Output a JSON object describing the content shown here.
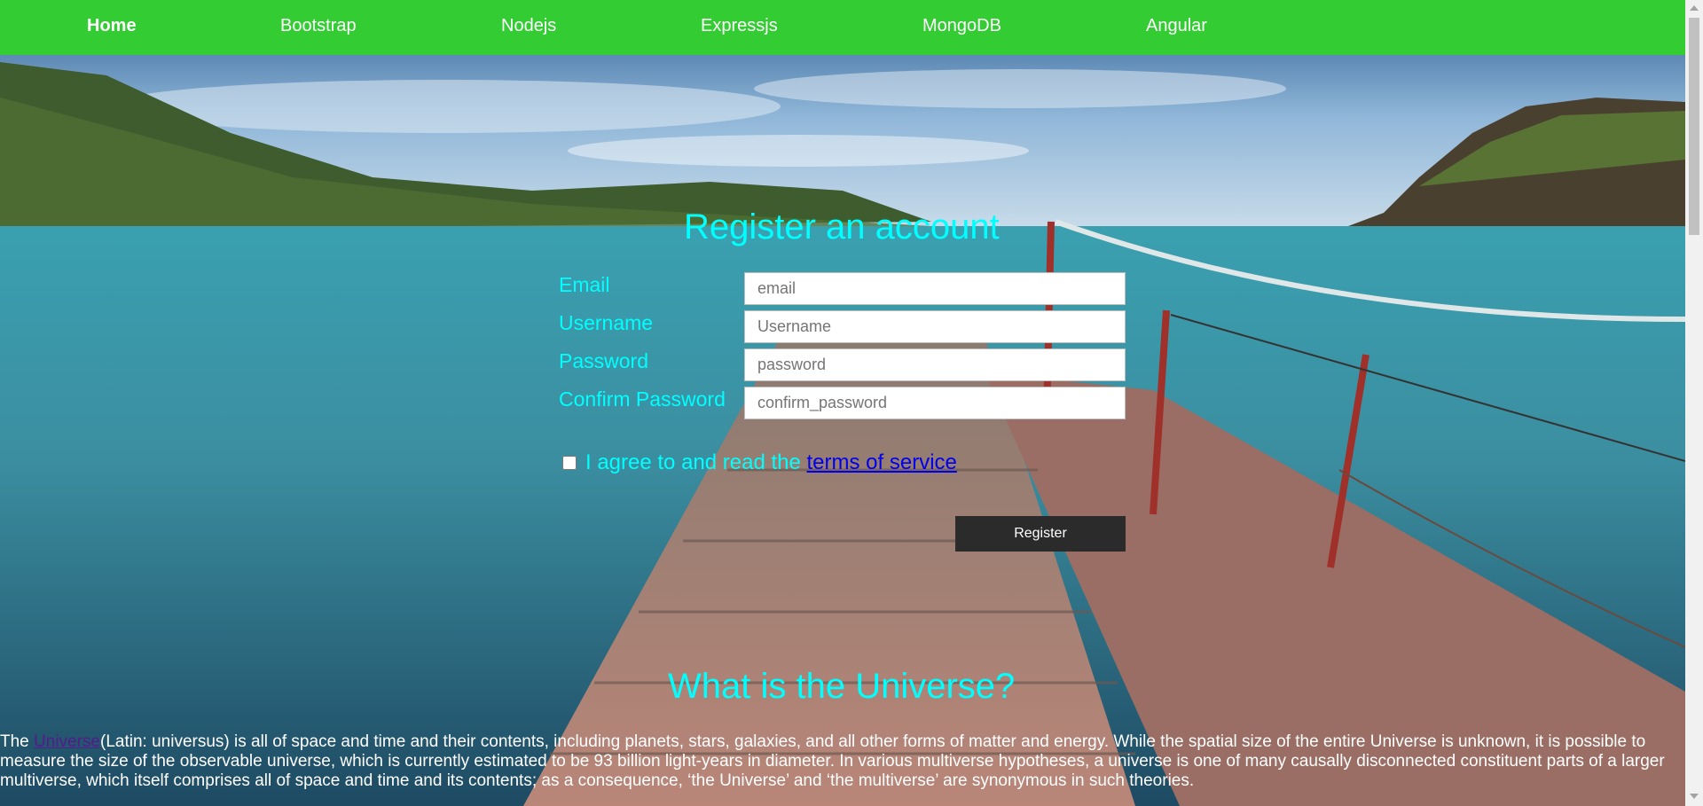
{
  "nav": {
    "items": [
      {
        "label": "Home",
        "active": true
      },
      {
        "label": "Bootstrap"
      },
      {
        "label": "Nodejs"
      },
      {
        "label": "Expressjs"
      },
      {
        "label": "MongoDB"
      },
      {
        "label": "Angular"
      }
    ],
    "color": "#33cc33"
  },
  "form": {
    "title": "Register an account",
    "email_label": "Email",
    "email_placeholder": "email",
    "username_label": "Username",
    "username_placeholder": "Username",
    "password_label": "Password",
    "password_placeholder": "password",
    "confirm_label": "Confirm Password",
    "confirm_placeholder": "confirm_password",
    "agree_text": "I agree to and read the ",
    "terms_link": "terms of service",
    "register_label": "Register",
    "accent": "#00ffff"
  },
  "article": {
    "title": "What is the Universe?",
    "lead": "The ",
    "link": "Universe",
    "body": "(Latin: universus) is all of space and time and their contents, including planets, stars, galaxies, and all other forms of matter and energy. While the spatial size of the entire Universe is unknown, it is possible to measure the size of the observable universe, which is currently estimated to be 93 billion light-years in diameter. In various multiverse hypotheses, a universe is one of many causally disconnected constituent parts of a larger multiverse, which itself comprises all of space and time and its contents; as a consequence, ‘the Universe’ and ‘the multiverse’ are synonymous in such theories."
  }
}
